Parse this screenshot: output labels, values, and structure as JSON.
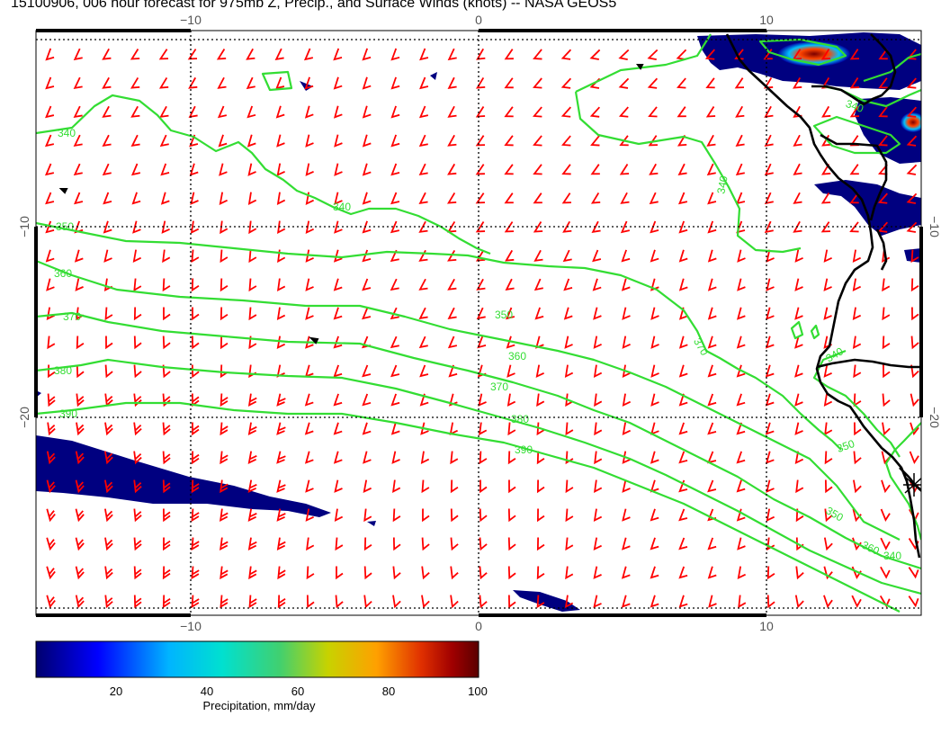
{
  "title": "15100906, 006 hour forecast for 975mb Z, Precip., and Surface Winds (knots) -- NASA GEOS5",
  "map": {
    "lon_labels": [
      "−10",
      "0",
      "10"
    ],
    "lat_labels": [
      "−10",
      "−20"
    ],
    "contour_labels": [
      "340",
      "340",
      "350",
      "360",
      "370",
      "380",
      "390",
      "340",
      "340",
      "350",
      "360",
      "370",
      "380",
      "390",
      "370",
      "350",
      "340",
      "350",
      "360",
      "340"
    ],
    "colors": {
      "wind_barbs": "#ff0000",
      "contours": "#33dd33",
      "coastline": "#000000",
      "precip_low": "#000080"
    }
  },
  "colorbar": {
    "ticks": [
      "20",
      "40",
      "60",
      "80",
      "100"
    ],
    "label": "Precipitation, mm/day",
    "colors": [
      "#00006e",
      "#0000ff",
      "#00b4ff",
      "#00e0d0",
      "#40d070",
      "#c8d200",
      "#ffa000",
      "#e03000",
      "#a00000",
      "#5a0000"
    ]
  }
}
